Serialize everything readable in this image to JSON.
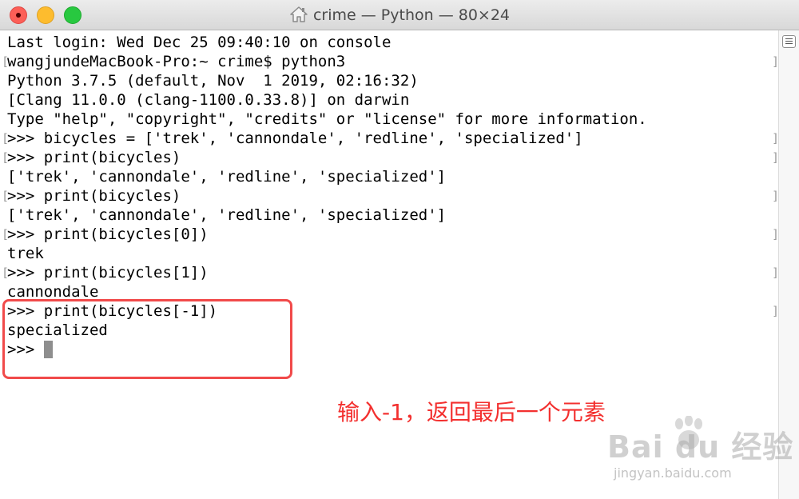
{
  "window": {
    "title": "crime — Python — 80×24",
    "icon": "home-icon"
  },
  "terminal": {
    "lines": [
      "Last login: Wed Dec 25 09:40:10 on console",
      "wangjundeMacBook-Pro:~ crime$ python3",
      "Python 3.7.5 (default, Nov  1 2019, 02:16:32)",
      "[Clang 11.0.0 (clang-1100.0.33.8)] on darwin",
      "Type \"help\", \"copyright\", \"credits\" or \"license\" for more information.",
      ">>> bicycles = ['trek', 'cannondale', 'redline', 'specialized']",
      ">>> print(bicycles)",
      "['trek', 'cannondale', 'redline', 'specialized']",
      ">>> print(bicycles)",
      "['trek', 'cannondale', 'redline', 'specialized']",
      ">>> print(bicycles[0])",
      "trek",
      ">>> print(bicycles[1])",
      "cannondale",
      ">>> print(bicycles[-1])",
      "specialized",
      ">>> "
    ],
    "mark_left": "[",
    "mark_right": "]"
  },
  "annotation": {
    "text": "输入-1，返回最后一个元素",
    "color": "#f3302f"
  },
  "watermark": {
    "main": "Bai  du 经验",
    "sub": "jingyan.baidu.com"
  },
  "colors": {
    "highlight_border": "#f14a4a",
    "text": "#000000",
    "cursor": "#8e8e8e"
  }
}
